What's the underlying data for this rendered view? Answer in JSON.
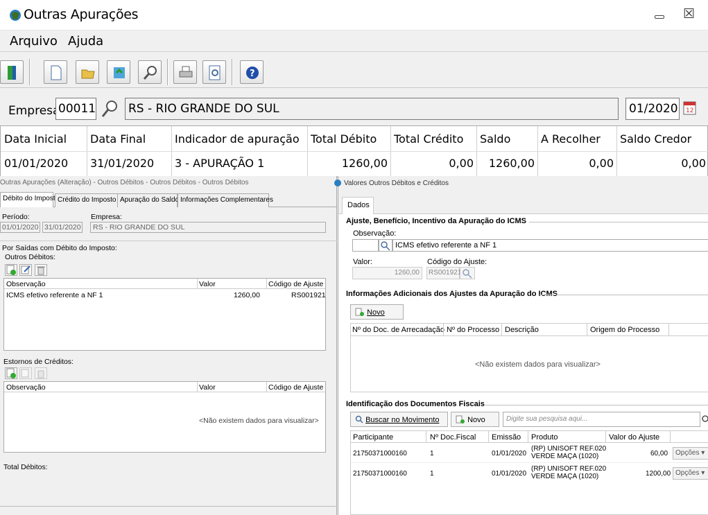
{
  "window": {
    "title": "Outras Apurações"
  },
  "menu": {
    "arquivo": "Arquivo",
    "ajuda": "Ajuda"
  },
  "toolbar_icons": [
    "exit-icon",
    "new-icon",
    "open-icon",
    "refresh-icon",
    "search-icon",
    "print-icon",
    "preview-icon",
    "help-icon"
  ],
  "empresa": {
    "label": "Empresa",
    "code": "00011",
    "name": "RS - RIO GRANDE DO SUL",
    "period": "01/2020"
  },
  "grid": {
    "headers": [
      "Data Inicial",
      "Data Final",
      "Indicador de apuração",
      "Total Débito",
      "Total Crédito",
      "Saldo",
      "A Recolher",
      "Saldo Credor"
    ],
    "row": [
      "01/01/2020",
      "31/01/2020",
      "3 - APURAÇÃO 1",
      "1260,00",
      "0,00",
      "1260,00",
      "0,00",
      "0,00"
    ]
  },
  "left": {
    "title": "Outras Apurações (Alteração) - Outros Débitos - Outros Débitos - Outros Débitos",
    "tabs": [
      "Débito do Imposto",
      "Crédito do Imposto",
      "Apuração do Saldo",
      "Informações Complementares"
    ],
    "periodo_label": "Período:",
    "empresa_label": "Empresa:",
    "periodo_ini": "01/01/2020",
    "periodo_fim": "31/01/2020",
    "empresa": "RS - RIO GRANDE DO SUL",
    "saidas_label": "Por Saídas com Débito do Imposto:",
    "outros_label": "Outros Débitos:",
    "col_obs": "Observação",
    "col_valor": "Valor",
    "col_codigo": "Código de Ajuste",
    "row_obs": "ICMS efetivo referente a NF 1",
    "row_valor": "1260,00",
    "row_codigo": "RS001921",
    "estornos_label": "Estornos de Créditos:",
    "empty": "<Não existem dados para visualizar>",
    "total_label": "Total Débitos:"
  },
  "right": {
    "title": "Valores Outros Débitos e Créditos",
    "tab": "Dados",
    "sec1": "Ajuste, Benefício, Incentivo da Apuração do ICMS",
    "obs_label": "Observação:",
    "obs_value": "ICMS efetivo referente a NF 1",
    "valor_label": "Valor:",
    "valor_value": "1260,00",
    "codigo_label": "Código do Ajuste:",
    "codigo_value": "RS001921",
    "sec2": "Informações Adicionais dos Ajustes da Apuração do ICMS",
    "novo": "Novo",
    "cols2": [
      "Nº do Doc. de Arrecadação",
      "Nº do Processo",
      "Descrição",
      "Origem do Processo"
    ],
    "empty": "<Não existem dados para visualizar>",
    "sec3": "Identificação dos Documentos Fiscais",
    "buscar": "Buscar no Movimento",
    "novo2": "Novo",
    "search_placeholder": "Digite sua pesquisa aqui...",
    "cols3": [
      "Participante",
      "Nº Doc.Fiscal",
      "Emissão",
      "Produto",
      "Valor do Ajuste"
    ],
    "rows3": [
      {
        "participante": "21750371000160",
        "doc": "1",
        "emissao": "01/01/2020",
        "produto1": "(RP) UNISOFT REF.020",
        "produto2": "VERDE MAÇA (1020)",
        "valor": "60,00",
        "opcoes": "Opções ▾"
      },
      {
        "participante": "21750371000160",
        "doc": "1",
        "emissao": "01/01/2020",
        "produto1": "(RP) UNISOFT REF.020",
        "produto2": "VERDE MAÇA (1020)",
        "valor": "1200,00",
        "opcoes": "Opções ▾"
      }
    ]
  },
  "colors": {
    "accent": "#1a5fb4",
    "toolbar_bg": "#f0f0f0"
  }
}
